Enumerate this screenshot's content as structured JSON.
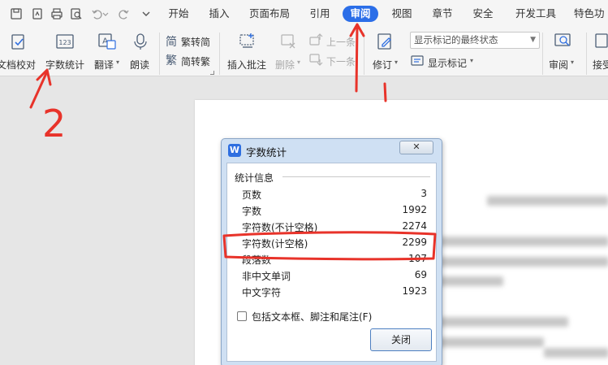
{
  "menubar": {
    "tabs": [
      "开始",
      "插入",
      "页面布局",
      "引用",
      "审阅",
      "视图",
      "章节",
      "安全",
      "开发工具",
      "特色功"
    ],
    "active_tab": "审阅"
  },
  "ribbon": {
    "doc_check": "文档校对",
    "word_count": "字数统计",
    "translate": "翻译",
    "read_aloud": "朗读",
    "trad_to_simp": "繁转简",
    "simp_to_trad": "简转繁",
    "insert_comment": "插入批注",
    "delete": "删除",
    "prev_item": "上一条",
    "next_item": "下一条",
    "track_changes": "修订",
    "markup_select": "显示标记的最终状态",
    "show_markup": "显示标记",
    "review": "审阅",
    "accept": "接受"
  },
  "dialog": {
    "title": "字数统计",
    "logo": "W",
    "close_button": "关闭",
    "group_title": "统计信息",
    "stats": [
      {
        "label": "页数",
        "value": "3"
      },
      {
        "label": "字数",
        "value": "1992"
      },
      {
        "label": "字符数(不计空格)",
        "value": "2274"
      },
      {
        "label": "字符数(计空格)",
        "value": "2299"
      },
      {
        "label": "段落数",
        "value": "107"
      },
      {
        "label": "非中文单词",
        "value": "69"
      },
      {
        "label": "中文字符",
        "value": "1923"
      }
    ],
    "include_checkbox": "包括文本框、脚注和尾注(F)",
    "include_checked": false
  },
  "annotation": {
    "step_number": "2",
    "color": "#e8332a"
  },
  "colors": {
    "active_tab_bg": "#2b6ee8",
    "accent_blue": "#2f6fe0"
  }
}
